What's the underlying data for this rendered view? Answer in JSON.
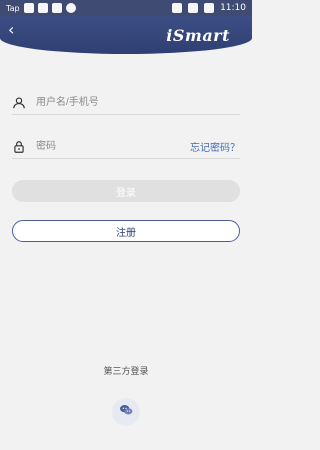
{
  "status": {
    "left_label": "Tap",
    "time": "11:10"
  },
  "header": {
    "back_glyph": "‹",
    "brand": "iSmart"
  },
  "form": {
    "username_placeholder": "用户名/手机号",
    "password_placeholder": "密码",
    "forgot_label": "忘记密码？",
    "login_label": "登录",
    "register_label": "注册"
  },
  "third_party": {
    "label": "第三方登录",
    "icons": [
      "wechat-icon"
    ]
  },
  "colors": {
    "primary": "#2f3f73",
    "accent": "#3f6bb3",
    "disabled": "#e0e0e0"
  }
}
